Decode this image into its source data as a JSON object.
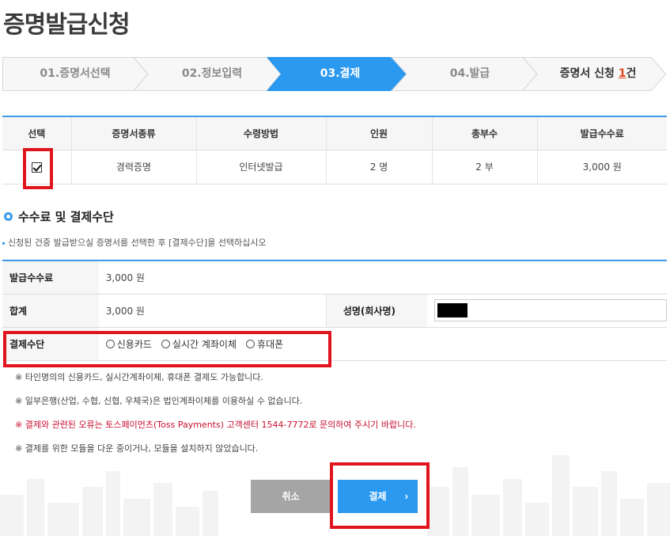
{
  "page_title": "증명발급신청",
  "steps": [
    {
      "label": "01.증명서선택",
      "state": "done"
    },
    {
      "label": "02.정보입력",
      "state": "done"
    },
    {
      "label": "03.결제",
      "state": "active"
    },
    {
      "label": "04.발급",
      "state": "pending"
    }
  ],
  "summary": {
    "prefix": "증명서 신청 ",
    "count": "1",
    "suffix": "건"
  },
  "list_table": {
    "headers": [
      "선택",
      "증명서종류",
      "수령방법",
      "인원",
      "총부수",
      "발급수수료"
    ],
    "row": {
      "checked": true,
      "type": "경력증명",
      "method": "인터넷발급",
      "people": "2 명",
      "copies": "2 부",
      "fee": "3,000 원"
    }
  },
  "section": {
    "title": "수수료 및 결제수단",
    "notice": "신청된 건중 발급받으실 증명서를 선택한 후 [결제수단]을 선택하십시오"
  },
  "pay_table": {
    "fee_label": "발급수수료",
    "fee_value": "3,000 원",
    "total_label": "합계",
    "total_value": "3,000 원",
    "name_label": "성명(회사명)",
    "method_label": "결제수단",
    "methods": [
      "신용카드",
      "실시간 계좌이체",
      "휴대폰"
    ]
  },
  "notes": [
    {
      "text": "※ 타인명의의 신용카드, 실시간계좌이체, 휴대폰 결제도 가능합니다.",
      "style": "normal"
    },
    {
      "text": "※ 일부은행(산업, 수협, 신협, 우체국)은 법인계좌이체를 이용하실 수 없습니다.",
      "style": "normal"
    },
    {
      "text": "※ 결제와 관련된 오류는 토스페이먼츠(Toss Payments) 고객센터 1544-7772로 문의하여 주시기 바랍니다.",
      "style": "red"
    },
    {
      "text": "※ 결제를 위한 모듈을 다운 중이거나, 모듈을 설치하지 않았습니다.",
      "style": "normal"
    }
  ],
  "buttons": {
    "cancel": "취소",
    "pay": "결제",
    "pay_chevron": "›"
  },
  "colors": {
    "accent": "#3d9be9",
    "active_step": "#2b99f0",
    "highlight": "#e0141e",
    "warning_text": "#c8102e"
  }
}
